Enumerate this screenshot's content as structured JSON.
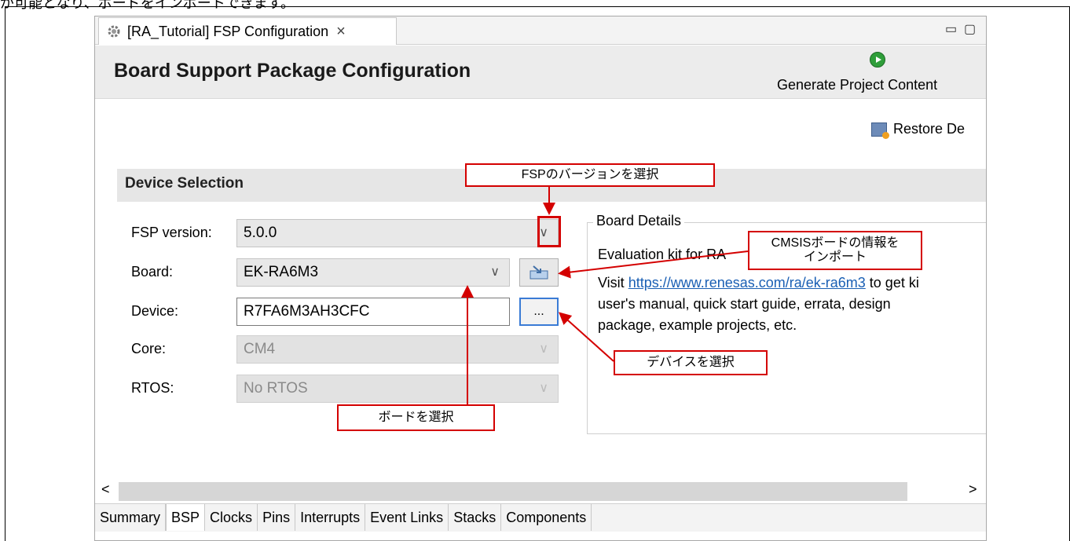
{
  "fragment": "が可能となり、ボードをインポートできます。",
  "tab": {
    "title": "[RA_Tutorial] FSP Configuration",
    "close": "×"
  },
  "window_controls": {
    "minimize": "▭",
    "maximize": "▢"
  },
  "header": {
    "title": "Board Support Package Configuration",
    "generate_label": "Generate Project Content"
  },
  "restore_label": "Restore De",
  "section_title": "Device Selection",
  "form": {
    "fsp_label": "FSP version:",
    "fsp_value": "5.0.0",
    "board_label": "Board:",
    "board_value": "EK-RA6M3",
    "device_label": "Device:",
    "device_value": "R7FA6M3AH3CFC",
    "device_btn": "...",
    "core_label": "Core:",
    "core_value": "CM4",
    "rtos_label": "RTOS:",
    "rtos_value": "No RTOS"
  },
  "details": {
    "legend": "Board Details",
    "line1": "Evaluation kit for RA",
    "visit": "Visit ",
    "link": "https://www.renesas.com/ra/ek-ra6m3",
    "rest": " to get ki",
    "line3": "user's manual, quick start guide, errata, design",
    "line4": "package, example projects, etc."
  },
  "callouts": {
    "fsp": "FSPのバージョンを選択",
    "cmsis_1": "CMSISボードの情報を",
    "cmsis_2": "インポート",
    "device": "デバイスを選択",
    "board": "ボードを選択"
  },
  "scroll": {
    "left": "<",
    "right": ">"
  },
  "bottom_tabs": [
    "Summary",
    "BSP",
    "Clocks",
    "Pins",
    "Interrupts",
    "Event Links",
    "Stacks",
    "Components"
  ],
  "colors": {
    "callout_border": "#d40000",
    "link": "#1a5fb4",
    "header_bg": "#ececec"
  }
}
